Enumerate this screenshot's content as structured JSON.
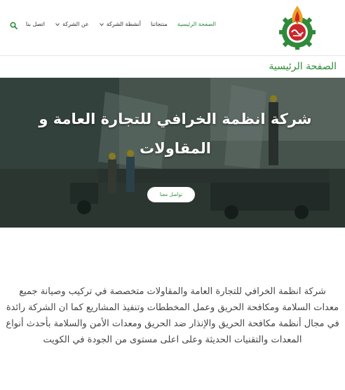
{
  "header": {
    "nav": [
      {
        "label": "الصفحة الرئيسية",
        "active": true,
        "dropdown": false
      },
      {
        "label": "منتجاتنا",
        "active": false,
        "dropdown": false
      },
      {
        "label": "أنشطة الشركة",
        "active": false,
        "dropdown": true
      },
      {
        "label": "عن الشركة",
        "active": false,
        "dropdown": true
      },
      {
        "label": "اتصل بنا",
        "active": false,
        "dropdown": false
      }
    ],
    "search_icon": "search-icon",
    "logo_icon": "company-logo"
  },
  "page": {
    "title": "الصفحة الرئيسية"
  },
  "hero": {
    "title": "شركة انظمة الخرافي للتجارة العامة و المقاولات",
    "button_label": "تواصل معنا"
  },
  "about": {
    "text": "شركة انظمة الخرافي للتجارة العامة والمقاولات متخصصة في تركيب وصيانة جميع معدات السلامة ومكافحة الحريق وعمل المخططات وتنفيذ المشاريع كما ان الشركة رائدة في مجال أنظمة مكافحة الحريق والإنذار ضد الحريق ومعدات الأمن والسلامة بأحدث أنواع المعدات والتقنيات الحديثة وعلى اعلى مستوى من الجودة في الكويت"
  },
  "colors": {
    "accent": "#2e8b3a",
    "logo_green": "#2f8a3a",
    "logo_red": "#c8282d",
    "logo_orange": "#f0a020"
  }
}
